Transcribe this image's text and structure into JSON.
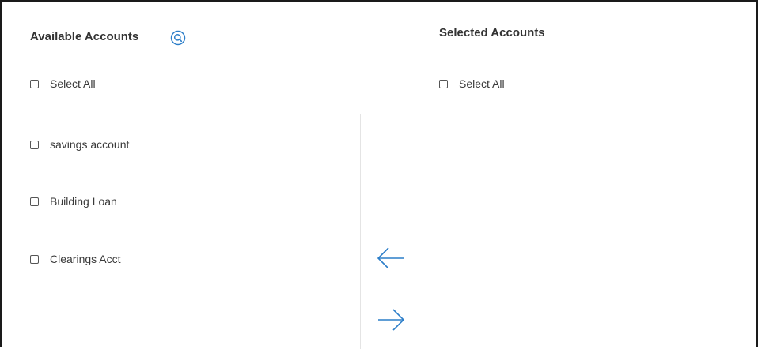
{
  "available": {
    "title": "Available Accounts",
    "select_all_label": "Select All",
    "accounts": [
      {
        "label": "savings account"
      },
      {
        "label": "Building Loan"
      },
      {
        "label": "Clearings Acct"
      }
    ]
  },
  "selected": {
    "title": "Selected Accounts",
    "select_all_label": "Select All"
  },
  "icons": {
    "search": "search-icon",
    "move_left": "arrow-left-icon",
    "move_right": "arrow-right-icon"
  },
  "colors": {
    "accent": "#2c7ec9",
    "text": "#333333",
    "divider": "#e4e4e4"
  }
}
